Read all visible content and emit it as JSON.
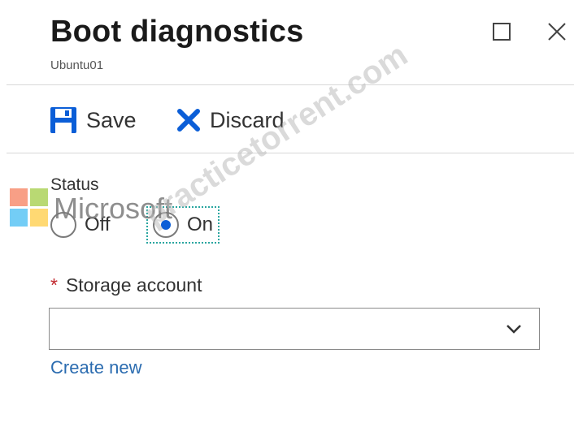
{
  "blade": {
    "title": "Boot diagnostics",
    "subtitle": "Ubuntu01"
  },
  "window_controls": {
    "maximize_icon": "square-icon",
    "close_icon": "x-icon"
  },
  "toolbar": {
    "save_label": "Save",
    "discard_label": "Discard",
    "save_icon": "floppy-disk-icon",
    "discard_icon": "x-icon"
  },
  "status": {
    "label": "Status",
    "options": [
      {
        "label": "Off",
        "selected": false
      },
      {
        "label": "On",
        "selected": true
      }
    ]
  },
  "storage": {
    "required_marker": "*",
    "label": "Storage account",
    "selected_value": "",
    "create_new_label": "Create new"
  },
  "overlay": {
    "microsoft_text": "Microsoft",
    "watermark_text": "practicetorrent.com"
  },
  "colors": {
    "accent": "#0b5ed7",
    "link": "#2b6cb0",
    "required": "#c1272d",
    "focus_border": "#2aa6a0"
  }
}
